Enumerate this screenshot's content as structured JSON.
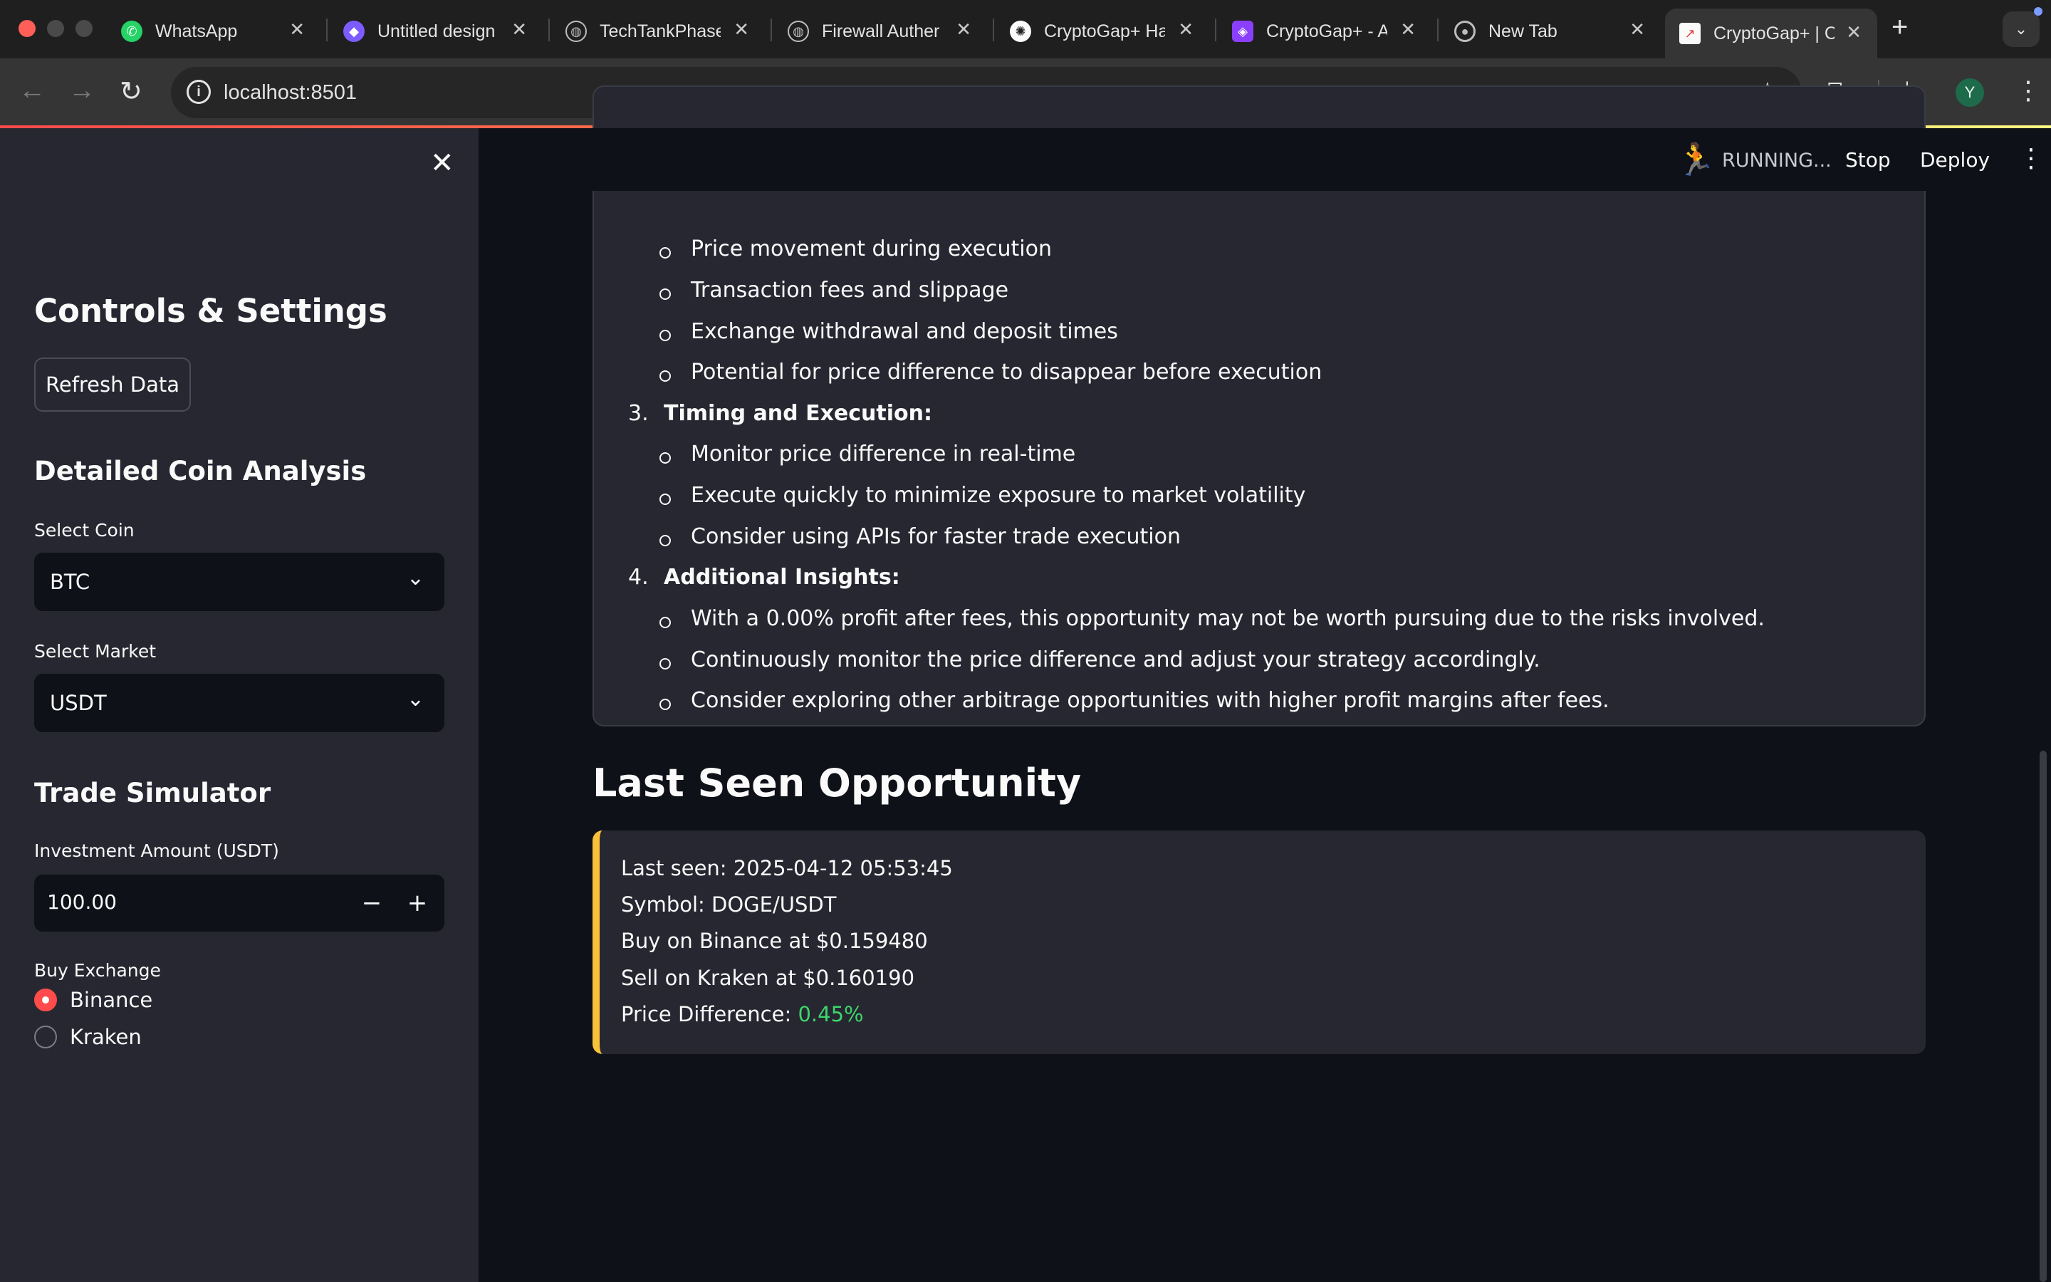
{
  "browser": {
    "tabs": [
      {
        "title": "WhatsApp",
        "icon": "whatsapp-icon"
      },
      {
        "title": "Untitled design",
        "icon": "canva-icon"
      },
      {
        "title": "TechTankPhase",
        "icon": "globe-icon"
      },
      {
        "title": "Firewall Auther",
        "icon": "globe-icon"
      },
      {
        "title": "CryptoGap+ Ha",
        "icon": "openai-icon"
      },
      {
        "title": "CryptoGap+ - A",
        "icon": "claude-icon"
      },
      {
        "title": "New Tab",
        "icon": "chrome-icon"
      },
      {
        "title": "CryptoGap+ | C",
        "icon": "chart-icon"
      }
    ],
    "url": "localhost:8501",
    "profile_initial": "Y"
  },
  "app_header": {
    "status": "RUNNING...",
    "stop": "Stop",
    "deploy": "Deploy"
  },
  "sidebar": {
    "title": "Controls & Settings",
    "refresh_button": "Refresh Data",
    "coin_section": "Detailed Coin Analysis",
    "select_coin_label": "Select Coin",
    "select_coin_value": "BTC",
    "select_market_label": "Select Market",
    "select_market_value": "USDT",
    "trade_section": "Trade Simulator",
    "investment_label": "Investment Amount (USDT)",
    "investment_value": "100.00",
    "buy_exchange_label": "Buy Exchange",
    "buy_exchange_options": [
      "Binance",
      "Kraken"
    ],
    "buy_exchange_selected": "Binance"
  },
  "main": {
    "analysis": {
      "risk_bullets": [
        "Price movement during execution",
        "Transaction fees and slippage",
        "Exchange withdrawal and deposit times",
        "Potential for price difference to disappear before execution"
      ],
      "sections": [
        {
          "number": "3.",
          "title": "Timing and Execution:",
          "bullets": [
            "Monitor price difference in real-time",
            "Execute quickly to minimize exposure to market volatility",
            "Consider using APIs for faster trade execution"
          ]
        },
        {
          "number": "4.",
          "title": "Additional Insights:",
          "bullets": [
            "With a 0.00% profit after fees, this opportunity may not be worth pursuing due to the risks involved.",
            "Continuously monitor the price difference and adjust your strategy accordingly.",
            "Consider exploring other arbitrage opportunities with higher profit margins after fees."
          ]
        }
      ]
    },
    "last_seen": {
      "heading": "Last Seen Opportunity",
      "last_seen": "Last seen: 2025-04-12 05:53:45",
      "symbol": "Symbol: DOGE/USDT",
      "buy": "Buy on Binance at $0.159480",
      "sell": "Sell on Kraken at $0.160190",
      "diff_label": "Price Difference: ",
      "diff_value": "0.45%"
    }
  },
  "colors": {
    "accent": "#ff4b4b",
    "callout_border": "#f7c23a",
    "positive": "#3dd56d"
  }
}
